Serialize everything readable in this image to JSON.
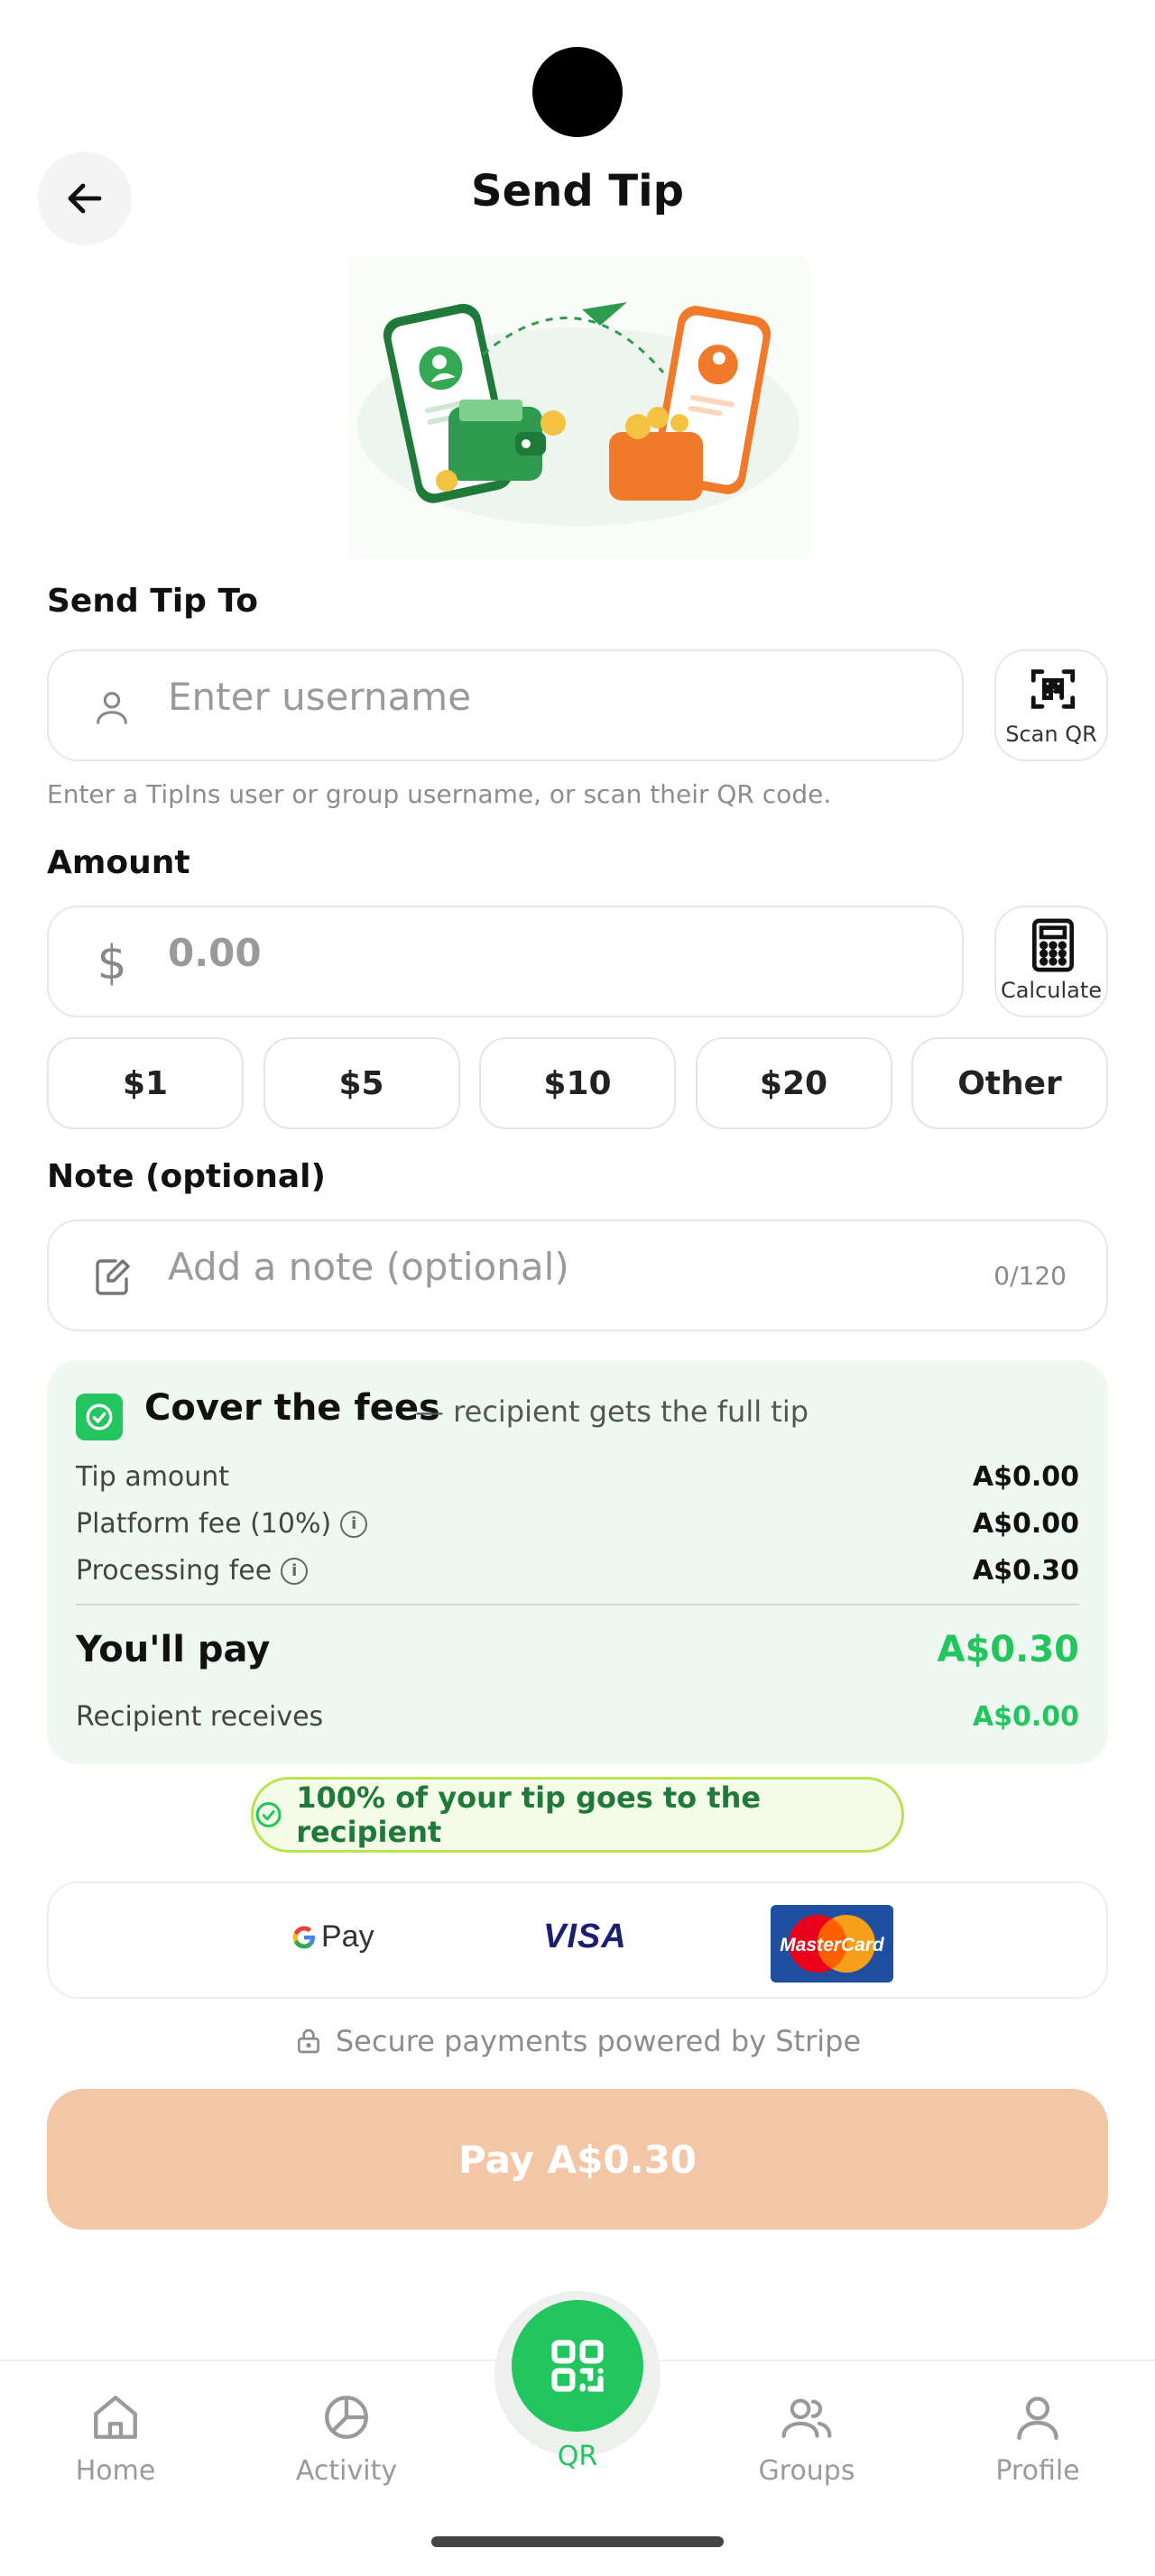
{
  "header": {
    "title": "Send Tip"
  },
  "recipient": {
    "label": "Send Tip To",
    "placeholder": "Enter username",
    "scan_label": "Scan QR",
    "helper": "Enter a TipIns user or group username, or scan their QR code."
  },
  "amount": {
    "label": "Amount",
    "currency_symbol": "$",
    "placeholder": "0.00",
    "calc_label": "Calculate",
    "presets": [
      "$1",
      "$5",
      "$10",
      "$20",
      "Other"
    ]
  },
  "note": {
    "label": "Note (optional)",
    "placeholder": "Add a note (optional)",
    "counter": "0/120"
  },
  "fees": {
    "title": "Cover the fees",
    "subtitle": "— recipient gets the full tip",
    "checked": true,
    "rows": [
      {
        "label": "Tip amount",
        "value": "A$0.00",
        "info": false
      },
      {
        "label": "Platform fee (10%)",
        "value": "A$0.00",
        "info": true
      },
      {
        "label": "Processing fee",
        "value": "A$0.30",
        "info": true
      }
    ],
    "total_label": "You'll pay",
    "total_value": "A$0.30",
    "receives_label": "Recipient receives",
    "receives_value": "A$0.00"
  },
  "badge": {
    "text": "100% of your tip goes to the recipient"
  },
  "payment_methods": {
    "gpay": "Pay",
    "visa": "VISA",
    "mastercard": "MasterCard"
  },
  "secure_text": "Secure payments powered by Stripe",
  "pay_button": "Pay A$0.30",
  "nav": {
    "home": "Home",
    "activity": "Activity",
    "qr": "QR",
    "groups": "Groups",
    "profile": "Profile"
  },
  "colors": {
    "accent_green": "#22c55e",
    "pay_button": "#f3c7a6",
    "fees_bg": "#eef8f0"
  }
}
